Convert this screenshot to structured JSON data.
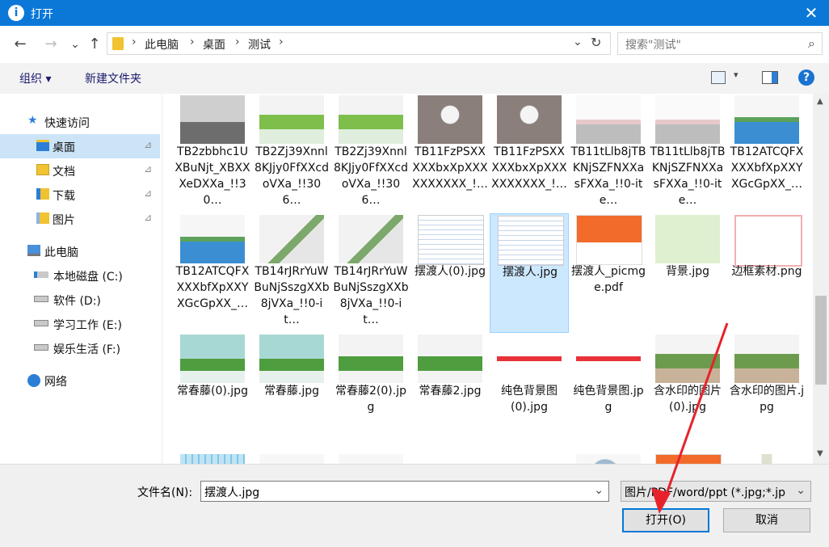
{
  "window": {
    "title": "打开",
    "app_icon_text": "i",
    "close_glyph": "✕"
  },
  "nav": {
    "back_glyph": "←",
    "forward_glyph": "→",
    "recent_glyph": "⌄",
    "up_glyph": "↑",
    "refresh_glyph": "↻",
    "dropdown_glyph": "⌄",
    "sep_glyph": "›"
  },
  "breadcrumb": [
    "此电脑",
    "桌面",
    "测试"
  ],
  "search": {
    "placeholder": "搜索\"测试\"",
    "icon_glyph": "⌕"
  },
  "toolbar": {
    "organize": "组织 ▾",
    "new_folder": "新建文件夹",
    "help_glyph": "?"
  },
  "sidebar": {
    "quick_access": "快速访问",
    "items": [
      {
        "label": "桌面",
        "pinned": true
      },
      {
        "label": "文档",
        "pinned": true
      },
      {
        "label": "下载",
        "pinned": true
      },
      {
        "label": "图片",
        "pinned": true
      }
    ],
    "this_pc": "此电脑",
    "drives": [
      "本地磁盘 (C:)",
      "软件 (D:)",
      "学习工作 (E:)",
      "娱乐生活 (F:)"
    ],
    "network": "网络",
    "pin_glyph": "⊿"
  },
  "files": [
    {
      "name": "TB2zbbhc1UXBuNjt_XBXXXeDXXa_!!30…",
      "kind": "photo"
    },
    {
      "name": "TB2Zj39Xnnl8KJjy0FfXXcdoVXa_!!306…",
      "kind": "plant"
    },
    {
      "name": "TB2Zj39Xnnl8KJjy0FfXXcdoVXa_!!306…",
      "kind": "plant"
    },
    {
      "name": "TB11FzPSXXXXXbxXpXXXXXXXXXX_!…",
      "kind": "vase"
    },
    {
      "name": "TB11FzPSXXXXXbxXpXXXXXXXXXX_!…",
      "kind": "vase"
    },
    {
      "name": "TB11tLlb8jTBKNjSZFNXXasFXXa_!!0-ite…",
      "kind": "flower"
    },
    {
      "name": "TB11tLlb8jTBKNjSZFNXXasFXXa_!!0-ite…",
      "kind": "flower"
    },
    {
      "name": "TB12ATCQFXXXXbfXpXXYXGcGpXX_…",
      "kind": "blue"
    },
    {
      "name": "TB12ATCQFXXXXbfXpXXYXGcGpXX_…",
      "kind": "blue"
    },
    {
      "name": "TB14rJRrYuWBuNjSszgXXb8jVXa_!!0-it…",
      "kind": "branch"
    },
    {
      "name": "TB14rJRrYuWBuNjSszgXXb8jVXa_!!0-it…",
      "kind": "branch"
    },
    {
      "name": "摆渡人(0).jpg",
      "kind": "doc"
    },
    {
      "name": "摆渡人.jpg",
      "kind": "doc"
    },
    {
      "name": "摆渡人_picmge.pdf",
      "kind": "pdf"
    },
    {
      "name": "背景.jpg",
      "kind": "green"
    },
    {
      "name": "边框素材.png",
      "kind": "frame"
    },
    {
      "name": "常春藤(0).jpg",
      "kind": "ivy"
    },
    {
      "name": "常春藤.jpg",
      "kind": "ivy"
    },
    {
      "name": "常春藤2(0).jpg",
      "kind": "ivy2"
    },
    {
      "name": "常春藤2.jpg",
      "kind": "ivy2"
    },
    {
      "name": "纯色背景图(0).jpg",
      "kind": "redbar"
    },
    {
      "name": "纯色背景图.jpg",
      "kind": "redbar"
    },
    {
      "name": "含水印的图片(0).jpg",
      "kind": "potted"
    },
    {
      "name": "含水印的图片.jpg",
      "kind": "potted"
    },
    {
      "name": "",
      "kind": "chart"
    },
    {
      "name": "",
      "kind": "succulent"
    },
    {
      "name": "",
      "kind": "succulent"
    },
    {
      "name": "",
      "kind": "empty"
    },
    {
      "name": "",
      "kind": "empty"
    },
    {
      "name": "",
      "kind": "magnifier"
    },
    {
      "name": "",
      "kind": "pdf"
    },
    {
      "name": "",
      "kind": "tall"
    }
  ],
  "selected_index": 12,
  "bottom": {
    "filename_label": "文件名(N):",
    "filename_value": "摆渡人.jpg",
    "filetype_value": "图片/PDF/word/ppt (*.jpg;*.jp",
    "open_label": "打开(O)",
    "cancel_label": "取消",
    "dropdown_glyph": "⌄"
  },
  "colors": {
    "accent": "#0b78d7",
    "annotation": "#e8222b",
    "selected_nav": "#cce4f7",
    "selected_tile": "#cce8ff"
  }
}
